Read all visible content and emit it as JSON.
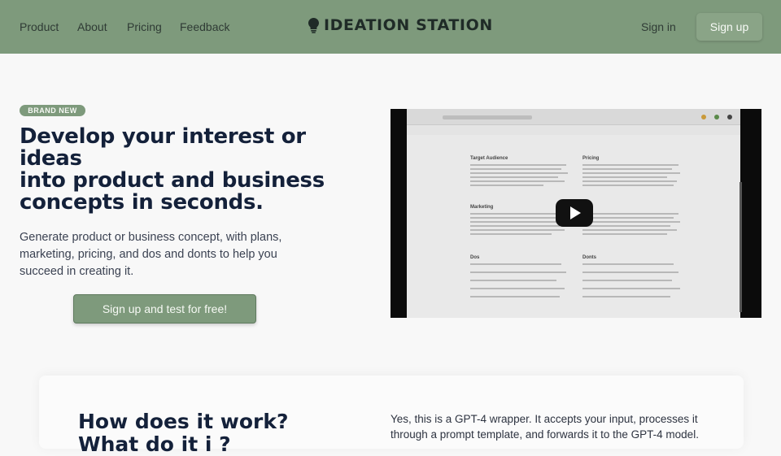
{
  "header": {
    "nav": [
      "Product",
      "About",
      "Pricing",
      "Feedback"
    ],
    "brand": "IDEATION STATION",
    "brand_icon": "lightbulb-icon",
    "signin": "Sign in",
    "signup": "Sign up"
  },
  "hero": {
    "badge": "BRAND NEW",
    "title_lines": [
      "Develop your interest or ideas",
      "into product and business",
      "concepts in seconds."
    ],
    "subtitle": "Generate product or business concept, with plans, marketing, pricing, and dos and donts to help you succeed in creating it.",
    "cta": "Sign up and test for free!"
  },
  "video": {
    "play_icon": "play-icon",
    "sections": [
      "Target Audience",
      "Pricing",
      "Marketing",
      "Dos",
      "Donts"
    ]
  },
  "how": {
    "title_lines": [
      "How does it work?",
      "What                    do      it     i   ?"
    ],
    "text": "Yes, this is a GPT-4 wrapper. It accepts your input, processes it through a prompt template, and forwards it to the GPT-4 model."
  },
  "colors": {
    "header_bg": "#7e9a7c",
    "accent": "#7e9a7c",
    "title": "#14213a"
  }
}
